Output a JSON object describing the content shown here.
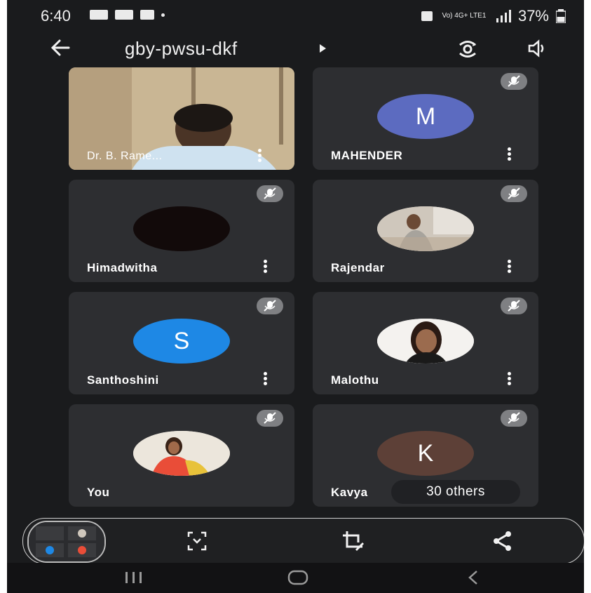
{
  "status": {
    "time": "6:40",
    "network": "Vo) 4G+ LTE1",
    "battery": "37%"
  },
  "header": {
    "meeting_code": "gby-pwsu-dkf"
  },
  "participants": [
    {
      "name": "Dr. B. Rame...",
      "type": "video",
      "muted": false
    },
    {
      "name": "MAHENDER",
      "type": "initial",
      "initial": "M",
      "color": "#5c6bc0",
      "muted": true
    },
    {
      "name": "Himadwitha",
      "type": "dark",
      "muted": true
    },
    {
      "name": "Rajendar",
      "type": "photo",
      "muted": true
    },
    {
      "name": "Santhoshini",
      "type": "initial",
      "initial": "S",
      "color": "#1e88e5",
      "muted": true
    },
    {
      "name": "Malothu",
      "type": "photo",
      "muted": true
    },
    {
      "name": "You",
      "type": "photo",
      "muted": true
    },
    {
      "name": "Kavya",
      "type": "initial",
      "initial": "K",
      "color": "#5d4037",
      "muted": true
    }
  ],
  "others_label": "30 others",
  "icons": {
    "back": "arrow-left-icon",
    "switch_camera": "switch-camera-icon",
    "speaker": "speaker-icon",
    "mic_off": "mic-off-icon",
    "more": "more-vert-icon",
    "expand": "expand-icon",
    "crop": "crop-edit-icon",
    "share": "share-icon"
  }
}
